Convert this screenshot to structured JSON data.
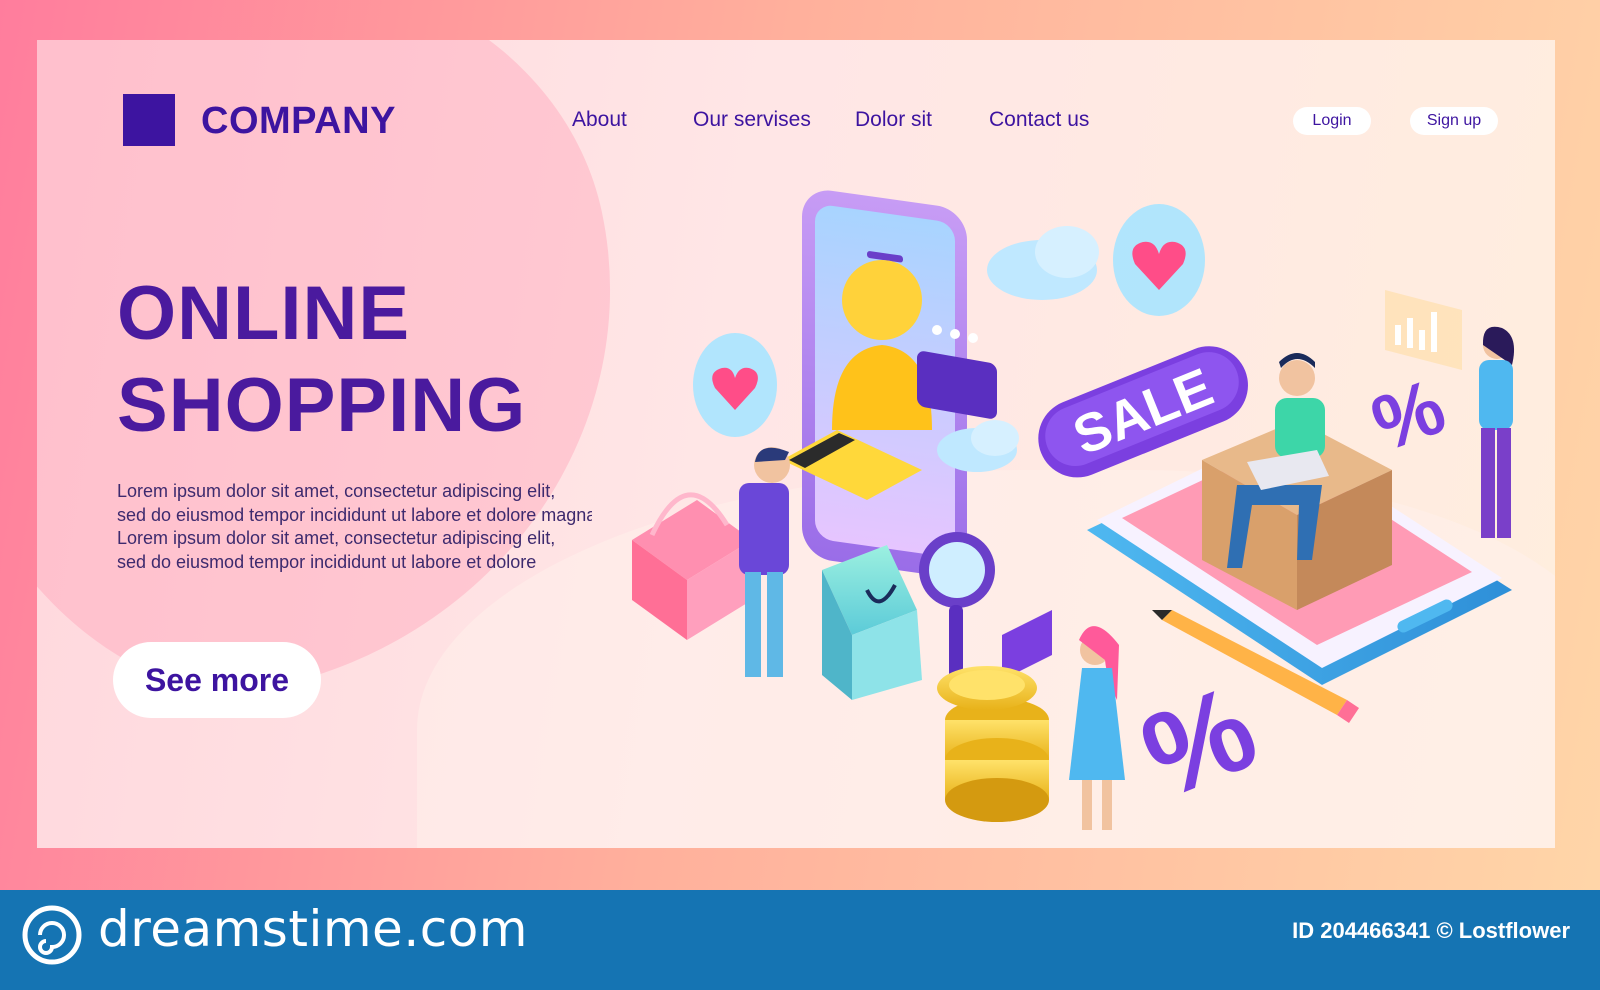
{
  "brand": {
    "name": "COMPANY",
    "logo_icon": "square-icon",
    "color": "#3d14a0"
  },
  "nav": {
    "links": [
      {
        "label": "About"
      },
      {
        "label": "Our servises"
      },
      {
        "label": "Dolor sit"
      },
      {
        "label": "Contact us"
      }
    ],
    "login_label": "Login",
    "signup_label": "Sign up"
  },
  "hero": {
    "title_line1": "ONLINE",
    "title_line2": "SHOPPING",
    "desc_lines": [
      "Lorem ipsum dolor sit amet, consectetur adipiscing elit,",
      "sed do eiusmod tempor incididunt ut labore et dolore magna",
      "Lorem ipsum dolor sit amet, consectetur adipiscing elit,",
      "sed do eiusmod tempor incididunt ut labore et dolore"
    ],
    "cta_label": "See more"
  },
  "illustration": {
    "sale_label": "SALE",
    "percent_label": "%",
    "icons": [
      "phone-icon",
      "heart-icon",
      "chat-icon",
      "cloud-icon",
      "basket-icon",
      "shopping-bag-icon",
      "magnifier-icon",
      "coins-icon",
      "box-icon",
      "pencil-icon",
      "credit-card-icon",
      "percent-icon"
    ]
  },
  "footer": {
    "site": "dreamstime.com",
    "id_text": "ID 204466341 © Lostflower"
  },
  "colors": {
    "accent": "#3d14a0",
    "purple": "#8a4be0",
    "pink": "#ff7d9d",
    "footer": "#1574b3"
  }
}
